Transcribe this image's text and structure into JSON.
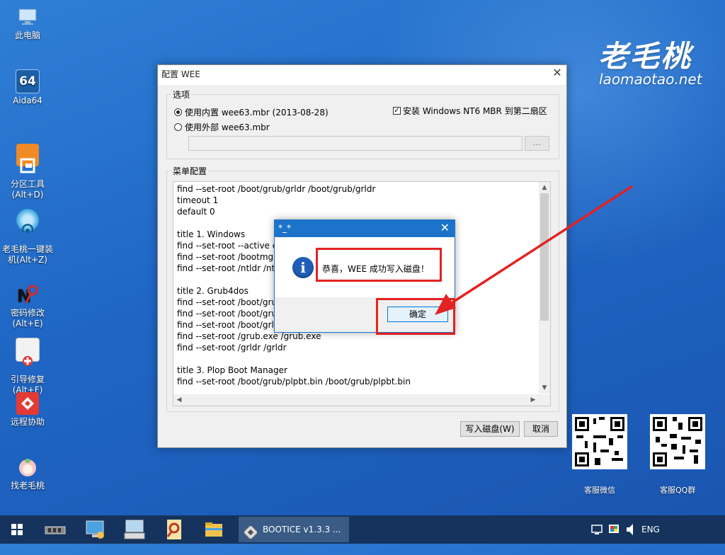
{
  "desktop": {
    "icons": [
      {
        "name": "computer-icon",
        "label": "此电脑",
        "color": "#9ec8ef"
      },
      {
        "name": "aida64-icon",
        "label": "Aida64",
        "badge": "64",
        "color": "#1b5fa8"
      },
      {
        "name": "partition-tool-icon",
        "label": "分区工具\n(Alt+D)",
        "color": "#f08a24"
      },
      {
        "name": "installer-icon",
        "label": "老毛桃一键装\n机(Alt+Z)",
        "color": "#38a3d9"
      },
      {
        "name": "password-icon",
        "label": "密码修改\n(Alt+E)",
        "color": "#d62828"
      },
      {
        "name": "boot-repair-icon",
        "label": "引导修复\n(Alt+F)",
        "color": "#e9e9e9"
      },
      {
        "name": "remote-help-icon",
        "label": "远程协助",
        "color": "#e53935"
      },
      {
        "name": "laomaotao-icon",
        "label": "找老毛桃",
        "color": "#f4c9c9"
      }
    ],
    "logo_cn": "老毛桃",
    "logo_en": "laomaotao.net",
    "qr_codes": [
      {
        "label": "客服微信"
      },
      {
        "label": "客服QQ群"
      }
    ]
  },
  "window": {
    "title": "配置 WEE",
    "options": {
      "legend": "选项",
      "radio_builtin": "使用内置 wee63.mbr (2013-08-28)",
      "radio_external": "使用外部 wee63.mbr",
      "checkbox_label": "安装 Windows NT6 MBR 到第二扇区",
      "browse_label": "..."
    },
    "menu_config": {
      "legend": "菜单配置",
      "lines": [
        "find --set-root /boot/grub/grldr /boot/grub/grldr",
        "timeout 1",
        "default 0",
        "",
        "title 1. Windows",
        "find --set-root --active c",
        "find --set-root /bootmgr",
        "find --set-root /ntldr /ntl",
        "",
        "title 2. Grub4dos",
        "find --set-root /boot/gru",
        "find --set-root /boot/gru",
        "find --set-root /boot/grld",
        "find --set-root /grub.exe /grub.exe",
        "find --set-root /grldr /grldr",
        "",
        "title 3. Plop Boot Manager",
        "find --set-root /boot/grub/plpbt.bin /boot/grub/plpbt.bin"
      ]
    },
    "write_button": "写入磁盘(W)",
    "cancel_button": "取消"
  },
  "message_box": {
    "title": "*_*",
    "text": "恭喜，WEE 成功写入磁盘！",
    "ok_button": "确定"
  },
  "taskbar": {
    "active_app": "BOOTICE v1.3.3 ...",
    "language": "ENG"
  },
  "colors": {
    "highlight": "#e32222",
    "title_blue": "#1c73c9",
    "taskbar": "#15335c"
  }
}
